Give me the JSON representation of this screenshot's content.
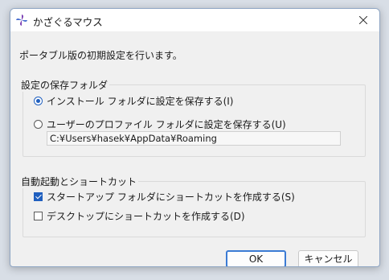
{
  "window": {
    "title": "かざぐるマウス"
  },
  "intro_text": "ポータブル版の初期設定を行います。",
  "storage_group": {
    "title": "設定の保存フォルダ",
    "options": [
      {
        "label": "インストール フォルダに設定を保存する(I)",
        "selected": true
      },
      {
        "label": "ユーザーのプロファイル フォルダに設定を保存する(U)",
        "selected": false
      }
    ],
    "path_value": "C:¥Users¥hasek¥AppData¥Roaming"
  },
  "shortcut_group": {
    "title": "自動起動とショートカット",
    "options": [
      {
        "label": "スタートアップ フォルダにショートカットを作成する(S)",
        "checked": true
      },
      {
        "label": "デスクトップにショートカットを作成する(D)",
        "checked": false
      }
    ]
  },
  "buttons": {
    "ok": "OK",
    "cancel": "キャンセル"
  },
  "colors": {
    "accent": "#1f5fbf",
    "default_button_border": "#3b7bd4"
  }
}
